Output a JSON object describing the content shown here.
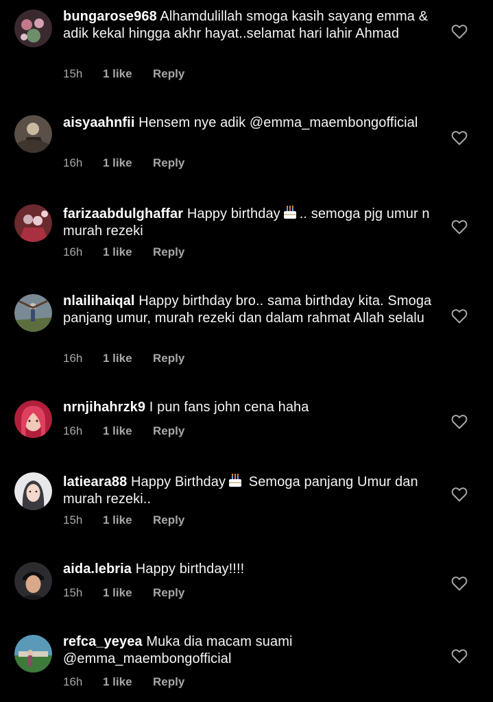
{
  "comments": [
    {
      "username": "bungarose968",
      "text_parts": [
        "Alhamdulillah smoga kasih sayang emma & adik kekal hingga akhr hayat..selamat hari lahir Ahmad"
      ],
      "time": "15h",
      "likes": "1 like",
      "reply": "Reply",
      "avatar_colors": [
        "#3a2a30",
        "#c27a8a",
        "#6d8f6a"
      ]
    },
    {
      "username": "aisyaahnfii",
      "text_parts": [
        "Hensem nye adik @emma_maembongofficial"
      ],
      "time": "16h",
      "likes": "1 like",
      "reply": "Reply",
      "avatar_colors": [
        "#5a5048",
        "#c9b9a0",
        "#2a2420"
      ]
    },
    {
      "username": "farizaabdulghaffar",
      "text_parts": [
        "Happy birthday",
        ".. semoga pjg umur n murah rezeki"
      ],
      "time": "16h",
      "likes": "1 like",
      "reply": "Reply",
      "avatar_colors": [
        "#6a2a2e",
        "#d0b0b8",
        "#a83040"
      ]
    },
    {
      "username": "nlailihaiqal",
      "text_parts": [
        "Happy birthday bro.. sama birthday kita. Smoga panjang umur, murah rezeki dan dalam rahmat Allah selalu"
      ],
      "time": "16h",
      "likes": "1 like",
      "reply": "Reply",
      "avatar_colors": [
        "#7a8a95",
        "#5c6e3e",
        "#c8c2b8"
      ]
    },
    {
      "username": "nrnjihahrzk9",
      "text_parts": [
        "I pun fans john cena haha"
      ],
      "time": "16h",
      "likes": "1 like",
      "reply": "Reply",
      "avatar_colors": [
        "#b0203a",
        "#f2c8b8",
        "#e04060"
      ]
    },
    {
      "username": "latieara88",
      "text_parts": [
        "Happy Birthday",
        " Semoga panjang Umur dan murah rezeki.."
      ],
      "time": "15h",
      "likes": "1 like",
      "reply": "Reply",
      "avatar_colors": [
        "#e8e8ea",
        "#3a3a40",
        "#f4d8cc"
      ]
    },
    {
      "username": "aida.lebria",
      "text_parts": [
        "Happy birthday!!!!"
      ],
      "time": "15h",
      "likes": "1 like",
      "reply": "Reply",
      "avatar_colors": [
        "#2c2c30",
        "#d9a888",
        "#0f0f12"
      ]
    },
    {
      "username": "refca_yeyea",
      "text_parts": [
        "Muka dia macam suami @emma_maembongofficial"
      ],
      "time": "16h",
      "likes": "1 like",
      "reply": "Reply",
      "avatar_colors": [
        "#5a9ab8",
        "#3e7a3a",
        "#d8d0c0"
      ]
    }
  ],
  "icons": {
    "like": "heart-icon",
    "cake": "birthday-cake-icon"
  },
  "colors": {
    "background": "#000000",
    "text": "#f5f5f5",
    "meta": "#a8a8a8"
  }
}
